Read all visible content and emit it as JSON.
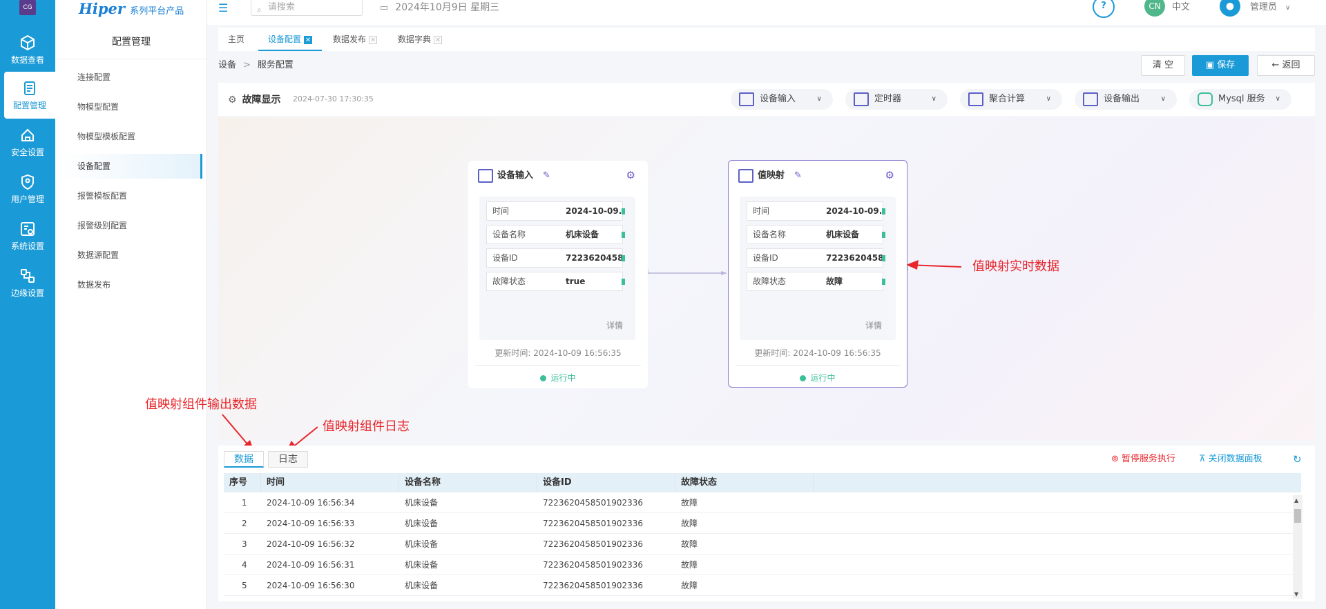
{
  "app": {
    "logo_text": "CG",
    "brand": "Hiper",
    "brand_sub": "系列平台产品"
  },
  "rail": [
    {
      "label": "数据查看",
      "icon": "data-view-icon"
    },
    {
      "label": "配置管理",
      "icon": "config-icon"
    },
    {
      "label": "安全设置",
      "icon": "security-icon"
    },
    {
      "label": "用户管理",
      "icon": "user-shield-icon"
    },
    {
      "label": "系统设置",
      "icon": "system-settings-icon"
    },
    {
      "label": "边缘设置",
      "icon": "edge-icon"
    }
  ],
  "sidebar": {
    "title": "配置管理",
    "items": [
      {
        "label": "连接配置"
      },
      {
        "label": "物模型配置"
      },
      {
        "label": "物模型模板配置"
      },
      {
        "label": "设备配置"
      },
      {
        "label": "报警模板配置"
      },
      {
        "label": "报警级别配置"
      },
      {
        "label": "数据源配置"
      },
      {
        "label": "数据发布"
      }
    ]
  },
  "header": {
    "search_placeholder": "请搜索",
    "date": "2024年10月9日 星期三",
    "lang_badge": "CN",
    "lang": "中文",
    "user": "管理员"
  },
  "tabs": [
    {
      "label": "主页"
    },
    {
      "label": "设备配置"
    },
    {
      "label": "数据发布"
    },
    {
      "label": "数据字典"
    }
  ],
  "breadcrumb": {
    "root": "设备",
    "current": "服务配置"
  },
  "actions": {
    "clear": "清 空",
    "save": "保存",
    "back": "返回"
  },
  "toolbar": {
    "title": "故障显示",
    "time": "2024-07-30 17:30:35",
    "dropdowns": [
      {
        "label": "设备输入"
      },
      {
        "label": "定时器"
      },
      {
        "label": "聚合计算"
      },
      {
        "label": "设备输出"
      },
      {
        "label": "Mysql 服务"
      }
    ]
  },
  "nodes": [
    {
      "title": "设备输入",
      "fields": [
        {
          "k": "时间",
          "v": "2024-10-09..."
        },
        {
          "k": "设备名称",
          "v": "机床设备"
        },
        {
          "k": "设备ID",
          "v": "72236204588..."
        },
        {
          "k": "故障状态",
          "v": "true"
        }
      ],
      "detail": "详情",
      "updated": "更新时间: 2024-10-09 16:56:35",
      "status": "运行中"
    },
    {
      "title": "值映射",
      "fields": [
        {
          "k": "时间",
          "v": "2024-10-09..."
        },
        {
          "k": "设备名称",
          "v": "机床设备"
        },
        {
          "k": "设备ID",
          "v": "72236204588..."
        },
        {
          "k": "故障状态",
          "v": "故障"
        }
      ],
      "detail": "详情",
      "updated": "更新时间: 2024-10-09 16:56:35",
      "status": "运行中"
    }
  ],
  "annotations": {
    "realtime": "值映射实时数据",
    "output": "值映射组件输出数据",
    "log": "值映射组件日志"
  },
  "panel": {
    "tabs": [
      "数据",
      "日志"
    ],
    "pause": "暂停服务执行",
    "close": "关闭数据面板",
    "columns": [
      "序号",
      "时间",
      "设备名称",
      "设备ID",
      "故障状态"
    ],
    "rows": [
      [
        "1",
        "2024-10-09 16:56:34",
        "机床设备",
        "7223620458501902336",
        "故障"
      ],
      [
        "2",
        "2024-10-09 16:56:33",
        "机床设备",
        "7223620458501902336",
        "故障"
      ],
      [
        "3",
        "2024-10-09 16:56:32",
        "机床设备",
        "7223620458501902336",
        "故障"
      ],
      [
        "4",
        "2024-10-09 16:56:31",
        "机床设备",
        "7223620458501902336",
        "故障"
      ],
      [
        "5",
        "2024-10-09 16:56:30",
        "机床设备",
        "7223620458501902336",
        "故障"
      ]
    ]
  },
  "colors": {
    "primary": "#1a9ad6",
    "success": "#3bbf99",
    "annotation": "#e8262b",
    "node_icon": "#5c5fc7"
  }
}
